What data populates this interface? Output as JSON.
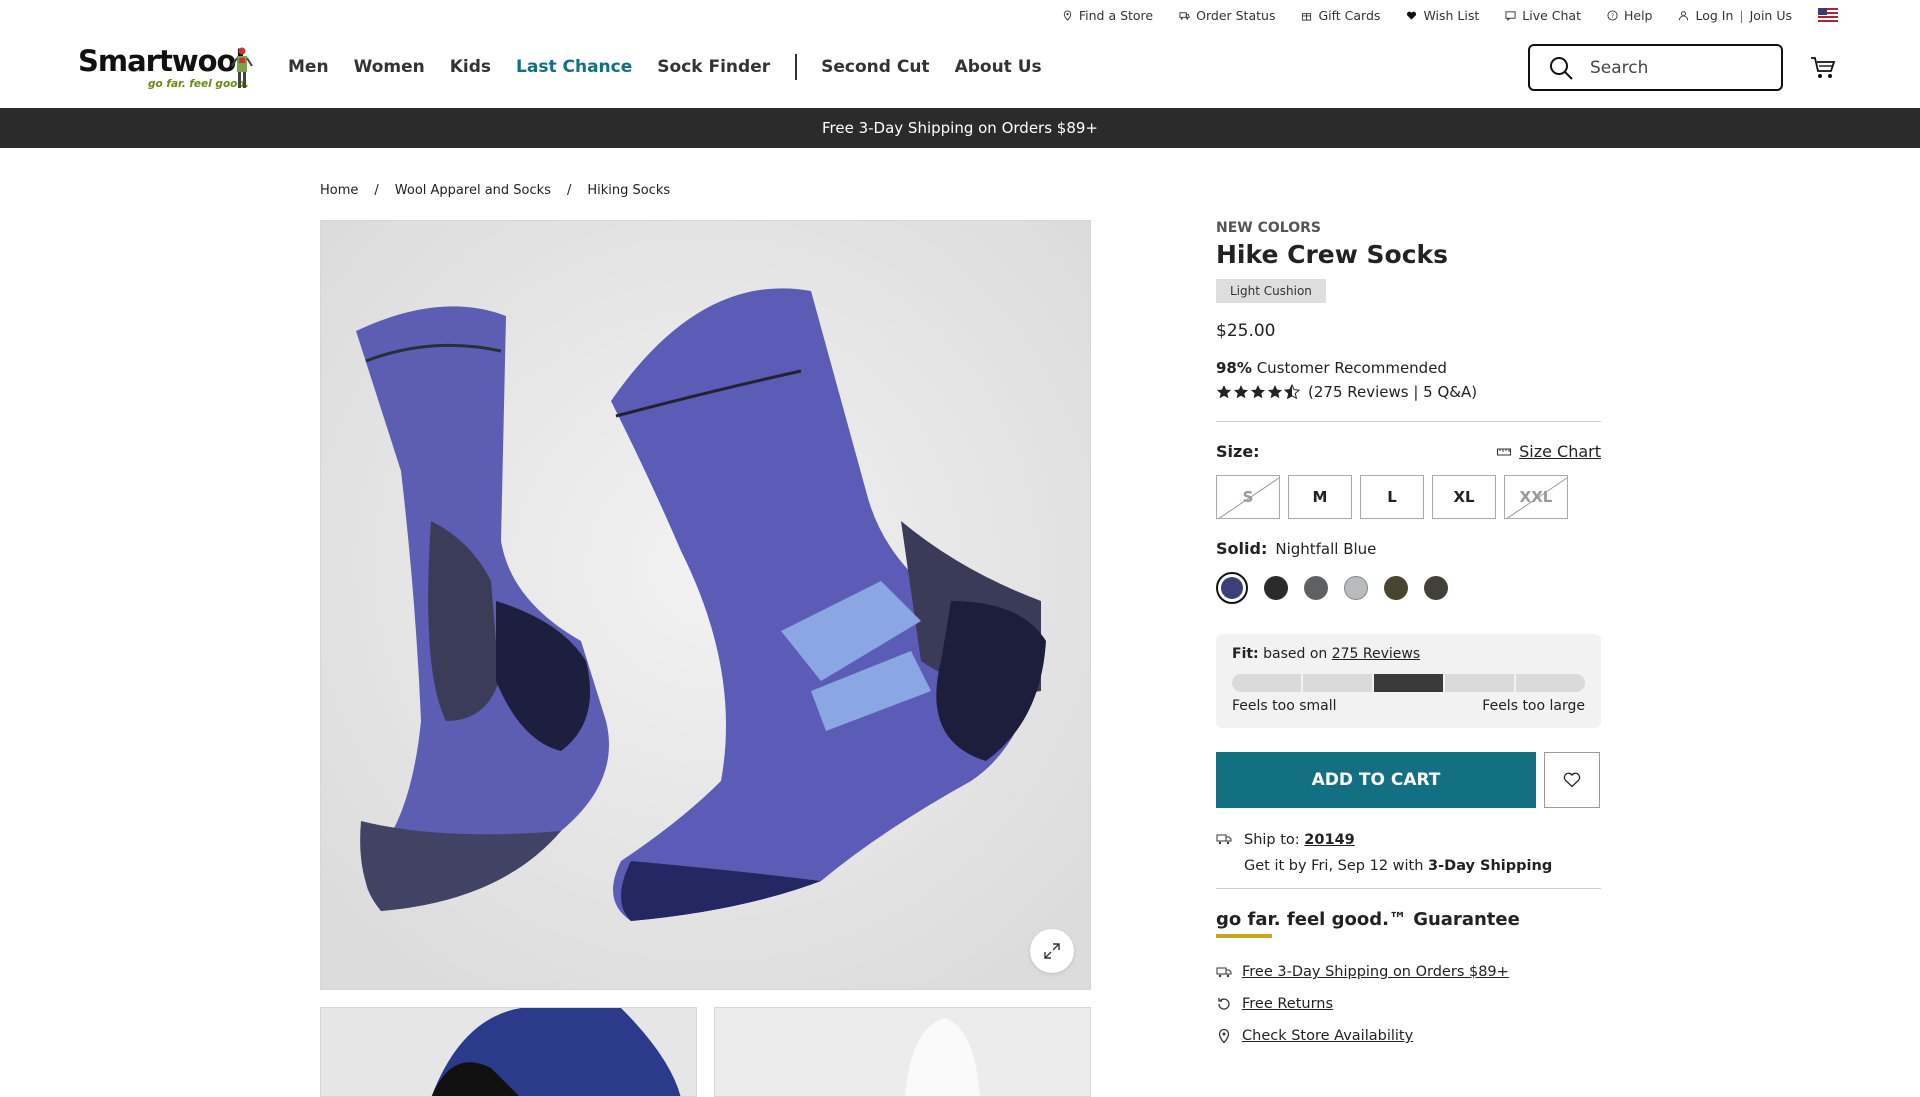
{
  "utility": {
    "find_store": "Find a Store",
    "order_status": "Order Status",
    "gift_cards": "Gift Cards",
    "wish_list": "Wish List",
    "live_chat": "Live Chat",
    "help": "Help",
    "log_in": "Log In",
    "separator": "|",
    "join_us": "Join Us"
  },
  "brand": {
    "name": "Smartwool",
    "tagline": "go far. feel good."
  },
  "nav": [
    "Men",
    "Women",
    "Kids",
    "Last Chance",
    "Sock Finder",
    "Second Cut",
    "About Us"
  ],
  "search": {
    "placeholder": "Search"
  },
  "promo": "Free 3-Day Shipping on Orders $89+",
  "breadcrumb": [
    "Home",
    "Wool Apparel and Socks",
    "Hiking Socks"
  ],
  "breadcrumb_sep": "/",
  "product": {
    "eyebrow": "New Colors",
    "title": "Hike Crew Socks",
    "cushion": "Light Cushion",
    "price": "$25.00",
    "recommended_pct": "98%",
    "recommended_text": "Customer Recommended",
    "rating": 4.5,
    "reviews_text": "(275 Reviews | 5 Q&A)"
  },
  "size": {
    "label": "Size:",
    "chart_link": "Size Chart",
    "options": [
      {
        "label": "S",
        "available": false
      },
      {
        "label": "M",
        "available": true
      },
      {
        "label": "L",
        "available": true
      },
      {
        "label": "XL",
        "available": true
      },
      {
        "label": "XXL",
        "available": false
      }
    ]
  },
  "color": {
    "label": "Solid:",
    "selected": "Nightfall Blue",
    "swatches": [
      "#3d3f78",
      "#2b2b2b",
      "#5f6062",
      "#b8bcbc",
      "#4a4530",
      "#44403a"
    ]
  },
  "fit": {
    "title": "Fit:",
    "based_on": "based on",
    "reviews_link": "275 Reviews",
    "segments": 5,
    "active_segment": 3,
    "low": "Feels too small",
    "high": "Feels too large"
  },
  "cta": {
    "add_to_cart": "ADD TO CART"
  },
  "shipping": {
    "ship_to": "Ship to:",
    "zip": "20149",
    "estimate_pre": "Get it by Fri, Sep 12 with",
    "estimate_method": "3-Day Shipping"
  },
  "guarantee": {
    "title": "go far. feel good.™ Guarantee",
    "perks": [
      "Free 3-Day Shipping on Orders $89+",
      "Free Returns",
      "Check Store Availability"
    ]
  },
  "colors": {
    "accent": "#136f82",
    "promo_bg": "#2b2b2b"
  }
}
